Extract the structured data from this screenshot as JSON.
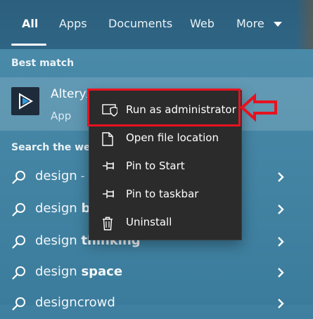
{
  "tabs": [
    {
      "label": "All",
      "active": true
    },
    {
      "label": "Apps",
      "active": false
    },
    {
      "label": "Documents",
      "active": false
    },
    {
      "label": "Web",
      "active": false
    },
    {
      "label": "More",
      "active": false
    }
  ],
  "best_match": {
    "section_label": "Best match",
    "app_name": "Alteryx",
    "app_kind": "App",
    "icon": "alteryx-app-icon"
  },
  "web": {
    "section_label": "Search the web",
    "results": [
      {
        "prefix": "design",
        "bold": "",
        "suffix": " - S"
      },
      {
        "prefix": "design ",
        "bold": "bu",
        "suffix": ""
      },
      {
        "prefix": "design ",
        "bold": "thinking",
        "suffix": ""
      },
      {
        "prefix": "design ",
        "bold": "space",
        "suffix": ""
      },
      {
        "prefix": "designcrowd",
        "bold": "",
        "suffix": ""
      }
    ]
  },
  "context_menu": {
    "items": [
      {
        "label": "Run as administrator",
        "icon": "shield-icon"
      },
      {
        "label": "Open file location",
        "icon": "file-icon"
      },
      {
        "label": "Pin to Start",
        "icon": "pin-icon"
      },
      {
        "label": "Pin to taskbar",
        "icon": "pin-icon"
      },
      {
        "label": "Uninstall",
        "icon": "trash-icon"
      }
    ]
  },
  "colors": {
    "highlight": "#e8121f",
    "menu_bg": "#2b2b2b",
    "panel_bg": "#3f7f9f"
  }
}
